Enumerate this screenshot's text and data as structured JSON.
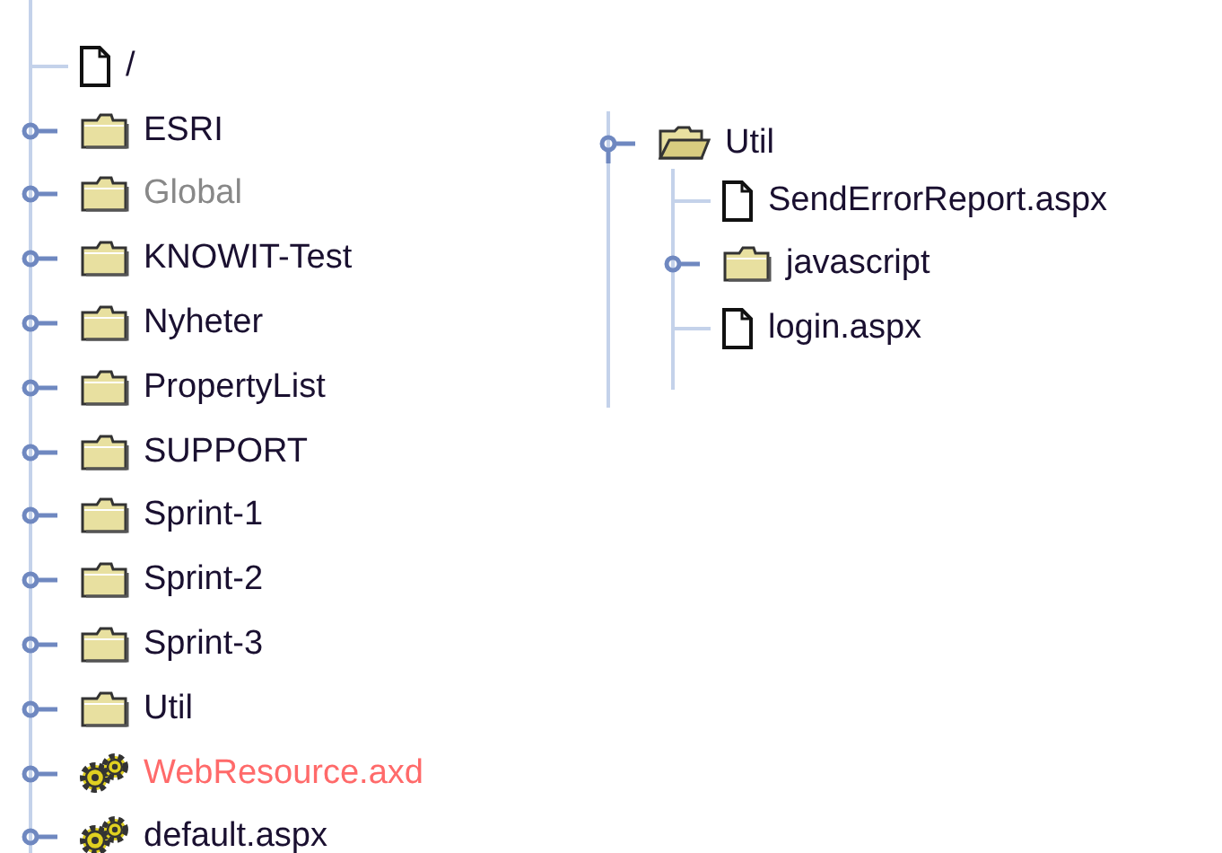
{
  "trees": [
    {
      "items": [
        {
          "kind": "file",
          "label": "/",
          "color": "#1a1030"
        },
        {
          "kind": "folder",
          "label": "ESRI",
          "color": "#1a1030",
          "expanded": false
        },
        {
          "kind": "folder",
          "label": "Global",
          "color": "#888888",
          "expanded": false
        },
        {
          "kind": "folder",
          "label": "KNOWIT-Test",
          "color": "#1a1030",
          "expanded": false
        },
        {
          "kind": "folder",
          "label": "Nyheter",
          "color": "#1a1030",
          "expanded": false
        },
        {
          "kind": "folder",
          "label": "PropertyList",
          "color": "#1a1030",
          "expanded": false
        },
        {
          "kind": "folder",
          "label": "SUPPORT",
          "color": "#1a1030",
          "expanded": false
        },
        {
          "kind": "folder",
          "label": "Sprint-1",
          "color": "#1a1030",
          "expanded": false
        },
        {
          "kind": "folder",
          "label": "Sprint-2",
          "color": "#1a1030",
          "expanded": false
        },
        {
          "kind": "folder",
          "label": "Sprint-3",
          "color": "#1a1030",
          "expanded": false
        },
        {
          "kind": "folder",
          "label": "Util",
          "color": "#1a1030",
          "expanded": false
        },
        {
          "kind": "handler",
          "label": "WebResource.axd",
          "color": "#ff6a6a",
          "expanded": false
        },
        {
          "kind": "handler",
          "label": "default.aspx",
          "color": "#1a1030",
          "expanded": false
        }
      ]
    },
    {
      "items": [
        {
          "kind": "folder",
          "label": "Util",
          "color": "#1a1030",
          "expanded": true,
          "children": [
            {
              "kind": "file",
              "label": "SendErrorReport.aspx",
              "color": "#1a1030"
            },
            {
              "kind": "folder",
              "label": "javascript",
              "color": "#1a1030",
              "expanded": false
            },
            {
              "kind": "file",
              "label": "login.aspx",
              "color": "#1a1030"
            }
          ]
        }
      ]
    }
  ]
}
